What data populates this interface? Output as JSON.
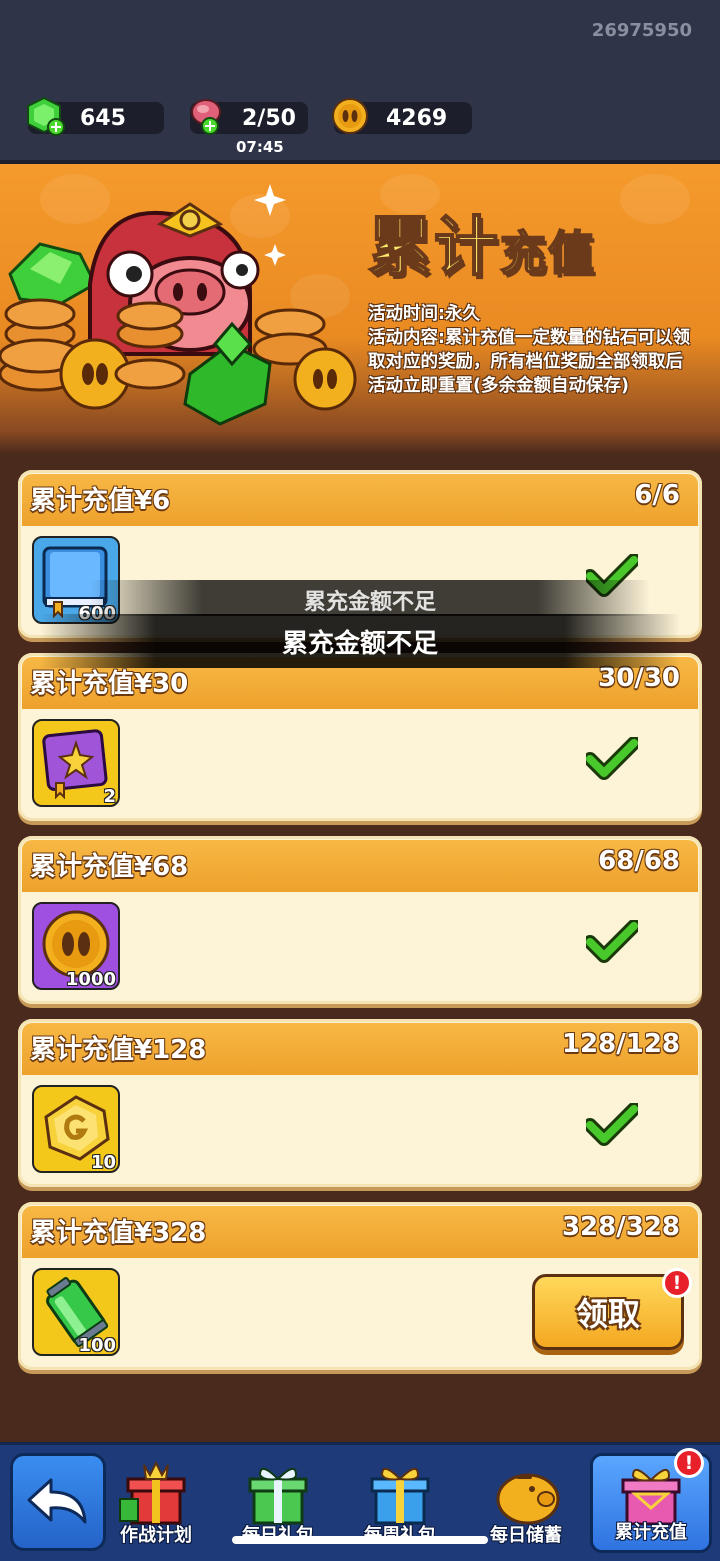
{
  "header": {
    "user_id": "26975950",
    "gems": "645",
    "energy": "2/50",
    "energy_timer": "07:45",
    "coins": "4269"
  },
  "banner": {
    "title_main": "累计",
    "title_sub": "充值",
    "time_line": "活动时间:永久",
    "content_line": "活动内容:累计充值一定数量的钻石可以领取对应的奖励，所有档位奖励全部领取后活动立即重置(多余金额自动保存)"
  },
  "tiers": [
    {
      "title": "累计充值¥6",
      "progress": "6/6",
      "reward_icon": "blue-book-icon",
      "reward_qty": "600",
      "status": "claimed"
    },
    {
      "title": "累计充值¥30",
      "progress": "30/30",
      "reward_icon": "purple-book-icon",
      "reward_qty": "2",
      "status": "claimed"
    },
    {
      "title": "累计充值¥68",
      "progress": "68/68",
      "reward_icon": "gold-coin-icon",
      "reward_qty": "1000",
      "status": "claimed"
    },
    {
      "title": "累计充值¥128",
      "progress": "128/128",
      "reward_icon": "gold-token-icon",
      "reward_qty": "10",
      "status": "claimed"
    },
    {
      "title": "累计充值¥328",
      "progress": "328/328",
      "reward_icon": "green-battery-icon",
      "reward_qty": "100",
      "status": "claimable",
      "claim_label": "领取"
    }
  ],
  "toast": {
    "message": "累充金额不足"
  },
  "bottom_nav": {
    "tabs": [
      {
        "label": "作战计划"
      },
      {
        "label": "每日礼包"
      },
      {
        "label": "每周礼包"
      },
      {
        "label": "每日储蓄"
      },
      {
        "label": "累计充值",
        "active": true
      }
    ]
  },
  "colors": {
    "header_bg": "#2f3448",
    "banner_orange": "#f59a2c",
    "card_header": "#f2aa35",
    "check_green": "#3cb81e",
    "nav_blue": "#1f3a78"
  }
}
